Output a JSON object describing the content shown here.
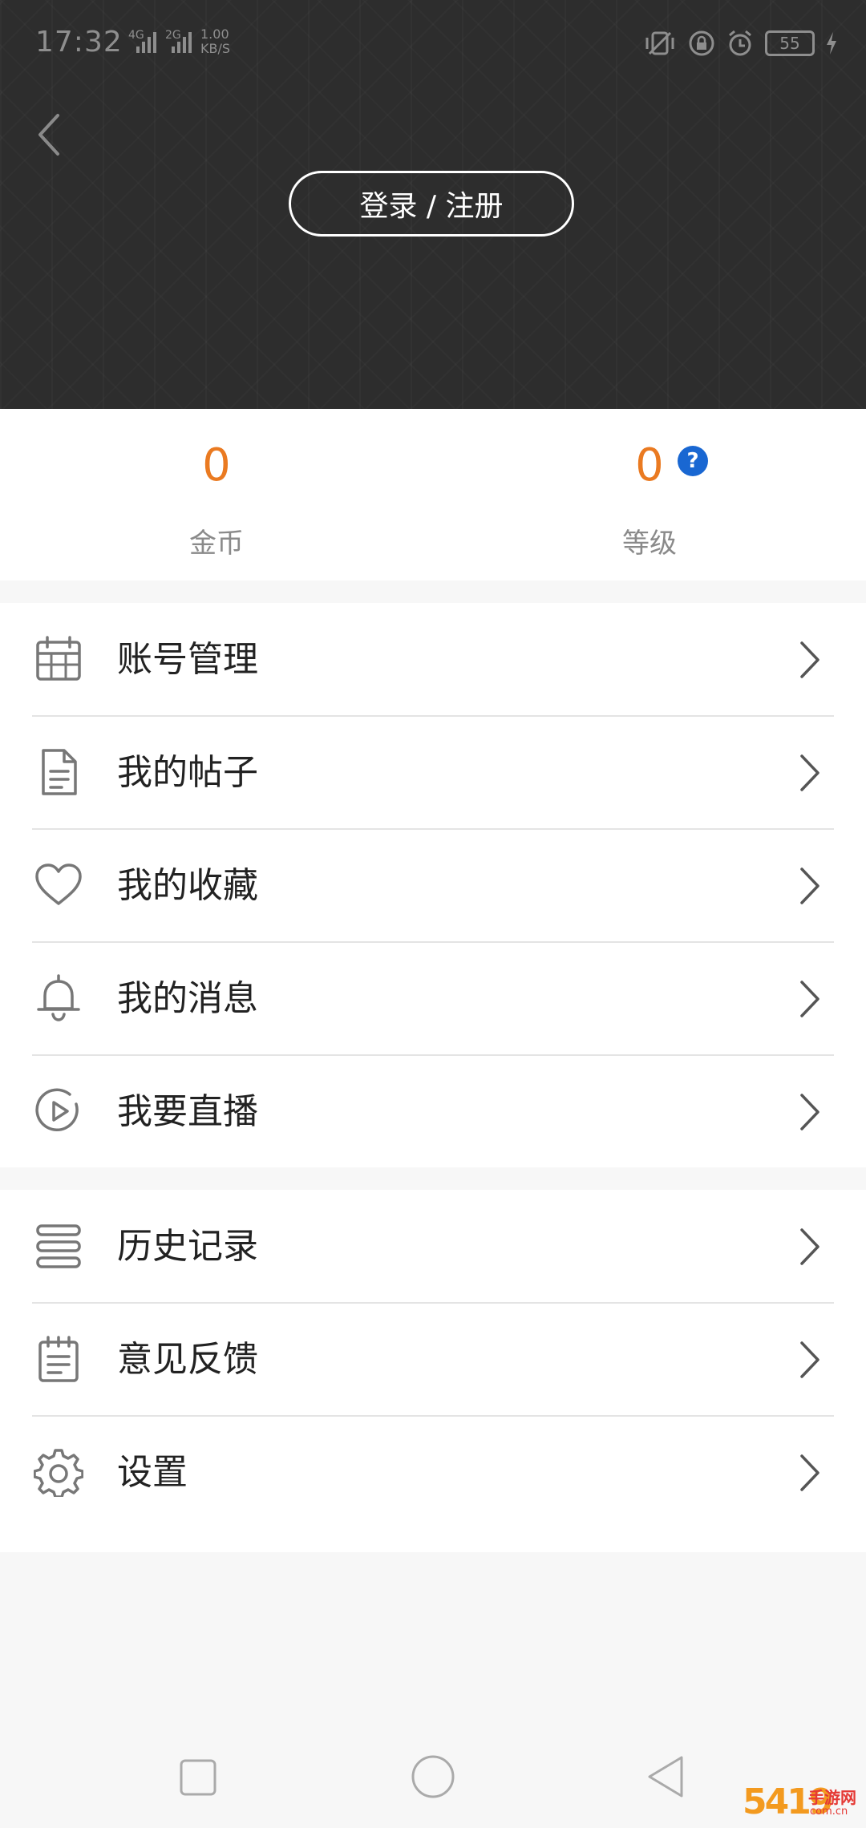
{
  "status_bar": {
    "time": "17:32",
    "signal1_label": "4G",
    "signal2_label": "2G",
    "speed_value": "1.00",
    "speed_unit": "KB/S",
    "battery": "55"
  },
  "header": {
    "login_label": "登录 / 注册"
  },
  "stats": {
    "coins_value": "0",
    "coins_label": "金币",
    "level_value": "0",
    "level_label": "等级",
    "level_help": "?"
  },
  "menu_group1": [
    {
      "label": "账号管理",
      "icon": "calendar-icon"
    },
    {
      "label": "我的帖子",
      "icon": "document-icon"
    },
    {
      "label": "我的收藏",
      "icon": "heart-icon"
    },
    {
      "label": "我的消息",
      "icon": "bell-icon"
    },
    {
      "label": "我要直播",
      "icon": "play-circle-icon"
    }
  ],
  "menu_group2": [
    {
      "label": "历史记录",
      "icon": "history-list-icon"
    },
    {
      "label": "意见反馈",
      "icon": "notepad-icon"
    },
    {
      "label": "设置",
      "icon": "gear-icon"
    }
  ],
  "watermark": {
    "number": "5419",
    "text": "手游网",
    "sub": "com.cn"
  },
  "colors": {
    "header_bg": "#2d2d2d",
    "accent_orange": "#ea7a21",
    "help_blue": "#1967d2",
    "text_dark": "#222222",
    "text_gray": "#8a8a8a"
  }
}
